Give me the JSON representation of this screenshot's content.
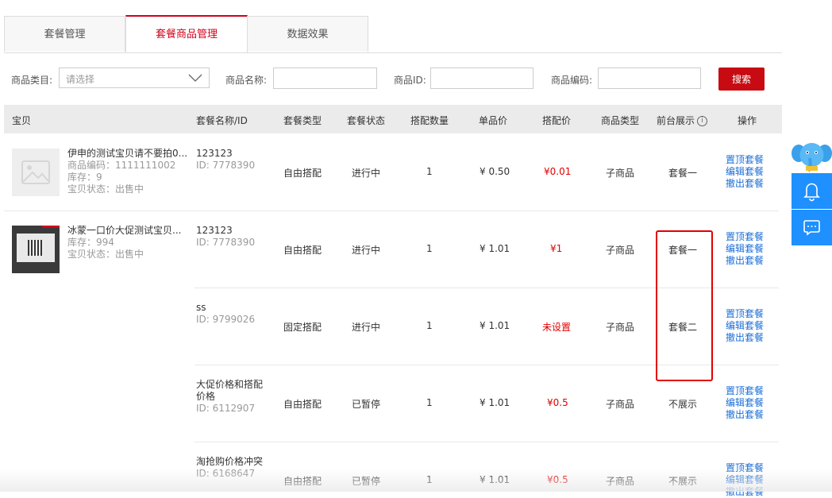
{
  "tabs": [
    {
      "label": "套餐管理"
    },
    {
      "label": "套餐商品管理"
    },
    {
      "label": "数据效果"
    }
  ],
  "filters": {
    "category_label": "商品类目:",
    "category_placeholder": "请选择",
    "name_label": "商品名称:",
    "id_label": "商品ID:",
    "code_label": "商品编码:",
    "search_button": "搜索"
  },
  "table": {
    "columns": [
      "宝贝",
      "套餐名称/ID",
      "套餐类型",
      "套餐状态",
      "搭配数量",
      "单品价",
      "搭配价",
      "商品类型",
      "前台展示",
      "操作"
    ],
    "products": [
      {
        "title": "伊申的测试宝贝请不要拍0...",
        "code": "商品编码：1111111002",
        "stock": "库存：9",
        "status": "宝贝状态：出售中"
      },
      {
        "title": "冰蒙一口价大促测试宝贝...",
        "stock": "库存：994",
        "status": "宝贝状态：出售中"
      }
    ],
    "rows": [
      {
        "name": "123123",
        "id": "ID: 7778390",
        "type": "自由搭配",
        "status": "进行中",
        "qty": "1",
        "unit_price": "¥ 0.50",
        "combo_price": "¥0.01",
        "goods_type": "子商品",
        "display": "套餐一"
      },
      {
        "name": "123123",
        "id": "ID: 7778390",
        "type": "自由搭配",
        "status": "进行中",
        "qty": "1",
        "unit_price": "¥ 1.01",
        "combo_price": "¥1",
        "goods_type": "子商品",
        "display": "套餐一"
      },
      {
        "name": "ss",
        "id": "ID: 9799026",
        "type": "固定搭配",
        "status": "进行中",
        "qty": "1",
        "unit_price": "¥ 1.01",
        "combo_price": "未设置",
        "goods_type": "子商品",
        "display": "套餐二"
      },
      {
        "name": "大促价格和搭配价格",
        "id": "ID: 6112907",
        "type": "自由搭配",
        "status": "已暂停",
        "qty": "1",
        "unit_price": "¥ 1.01",
        "combo_price": "¥0.5",
        "goods_type": "子商品",
        "display": "不展示"
      },
      {
        "name": "淘抢购价格冲突",
        "id": "ID: 6168647",
        "type": "自由搭配",
        "status": "已暂停",
        "qty": "1",
        "unit_price": "¥ 1.01",
        "combo_price": "¥0.5",
        "goods_type": "子商品",
        "display": "不展示"
      }
    ],
    "actions": {
      "pin": "置顶套餐",
      "edit": "编辑套餐",
      "withdraw": "撤出套餐"
    }
  },
  "colors": {
    "accent": "#c80b12",
    "price_red": "#e10000",
    "link": "#1a6ed8",
    "side_blue": "#1e90ff",
    "highlight_box": "#e30000"
  },
  "icons": [
    "chevron-down-icon",
    "info-icon",
    "image-placeholder-icon",
    "bell-icon",
    "chat-icon",
    "elephant-mascot-icon"
  ]
}
